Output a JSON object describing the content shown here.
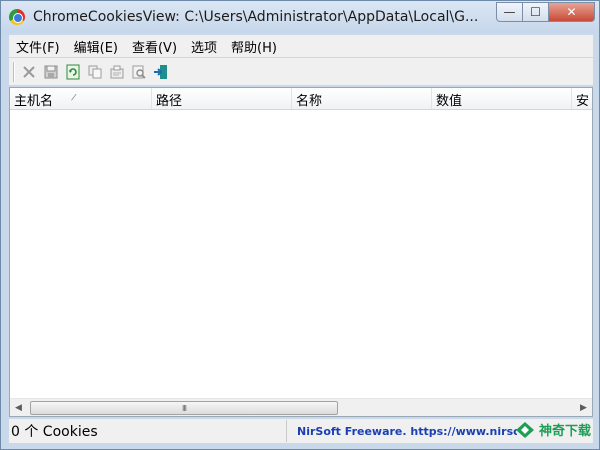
{
  "window": {
    "title": "ChromeCookiesView:   C:\\Users\\Administrator\\AppData\\Local\\G...",
    "controls": {
      "minimize": "—",
      "maximize": "☐",
      "close": "✕"
    }
  },
  "menu": {
    "items": [
      "文件(F)",
      "编辑(E)",
      "查看(V)",
      "选项",
      "帮助(H)"
    ]
  },
  "toolbar": {
    "buttons": [
      "delete-icon",
      "save-icon",
      "refresh-icon",
      "copy-icon",
      "properties-icon",
      "find-icon",
      "exit-icon"
    ]
  },
  "list": {
    "columns": [
      "主机名",
      "路径",
      "名称",
      "数值",
      "安"
    ],
    "sort_indicator": "/",
    "rows": []
  },
  "scrollbar": {
    "grip": "III"
  },
  "status": {
    "count": "0 个 Cookies",
    "link": "NirSoft Freeware.  https://www.nirsoft.net"
  },
  "watermark": {
    "text": "神奇下载"
  },
  "colors": {
    "accent_link": "#1a3fb2",
    "watermark": "#1e9e55",
    "close_button": "#c94a36"
  }
}
